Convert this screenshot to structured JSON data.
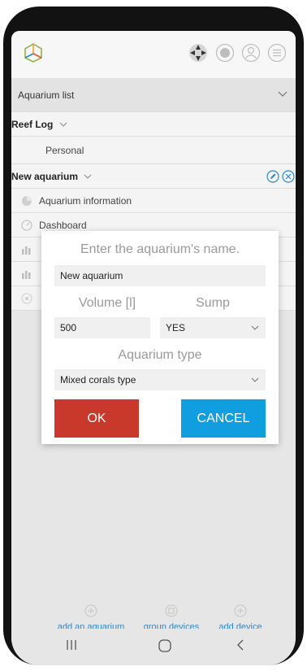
{
  "header": {
    "icons": [
      "logo-icon",
      "move-icon",
      "globe-icon",
      "user-icon",
      "menu-icon"
    ]
  },
  "list": {
    "dropdown_label": "Aquarium list",
    "group_label": "Reef Log",
    "personal_label": "Personal",
    "aquarium_label": "New aquarium",
    "menu_items": [
      {
        "label": "Aquarium information",
        "icon": "info-pie-icon"
      },
      {
        "label": "Dashboard",
        "icon": "gauge-icon"
      }
    ]
  },
  "dialog": {
    "name_title": "Enter the aquarium's name.",
    "name_value": "New aquarium",
    "volume_label": "Volume [l]",
    "sump_label": "Sump",
    "volume_value": "500",
    "sump_value": "YES",
    "type_label": "Aquarium type",
    "type_value": "Mixed corals type",
    "ok_label": "OK",
    "cancel_label": "CANCEL"
  },
  "bottom_actions": [
    {
      "label": "add an aquarium",
      "icon": "plus-circle-icon"
    },
    {
      "label": "group devices",
      "icon": "group-devices-icon"
    },
    {
      "label": "add device",
      "icon": "plus-circle-icon"
    }
  ],
  "colors": {
    "accent_blue": "#2f86c8",
    "ok_red": "#c8392b",
    "cancel_blue": "#109ee0"
  },
  "android_nav": [
    "recents-icon",
    "home-icon",
    "back-icon"
  ]
}
